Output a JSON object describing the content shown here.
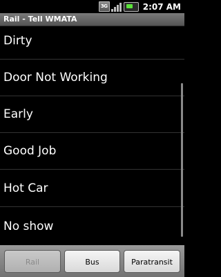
{
  "status_bar": {
    "network_label": "3G",
    "clock": "2:07 AM",
    "icons": [
      "network-3g-icon",
      "signal-icon",
      "battery-icon"
    ],
    "battery_color": "#5be23a"
  },
  "title_bar": {
    "title": "Rail - Tell WMATA"
  },
  "list": {
    "items": [
      {
        "label": "Dirty"
      },
      {
        "label": "Door Not Working"
      },
      {
        "label": "Early"
      },
      {
        "label": "Good Job"
      },
      {
        "label": "Hot Car"
      },
      {
        "label": "No show"
      }
    ]
  },
  "tabs": {
    "items": [
      {
        "label": "Rail",
        "enabled": false
      },
      {
        "label": "Bus",
        "enabled": true
      },
      {
        "label": "Paratransit",
        "enabled": true
      }
    ]
  }
}
